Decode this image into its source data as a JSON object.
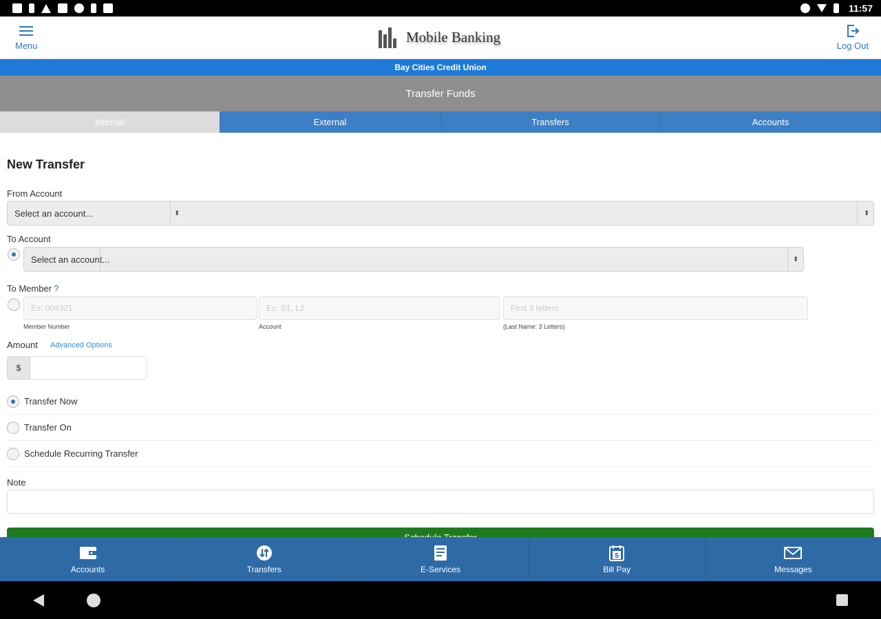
{
  "status_bar": {
    "time": "11:57",
    "left_icons": [
      "app-icon",
      "upload-icon",
      "warning-icon",
      "image-icon",
      "circle-icon",
      "phone-icon",
      "play-store-icon"
    ],
    "right_icons": [
      "data-saver-icon",
      "wifi-icon",
      "battery-icon"
    ]
  },
  "header": {
    "menu_label": "Menu",
    "logo_text": "Mobile Banking",
    "logout_label": "Log Out"
  },
  "bank_name": "Bay Cities Credit Union",
  "page_title": "Transfer Funds",
  "tabs": [
    {
      "label": "Internal",
      "active": true
    },
    {
      "label": "External",
      "active": false
    },
    {
      "label": "Transfers",
      "active": false
    },
    {
      "label": "Accounts",
      "active": false
    }
  ],
  "form": {
    "heading": "New Transfer",
    "from_account": {
      "label": "From Account",
      "value": "Select an account..."
    },
    "to_account": {
      "label": "To Account",
      "value": "Select an account..."
    },
    "to_member": {
      "label": "To Member",
      "help": "?",
      "member_number": {
        "placeholder": "Ex: 004321",
        "hint": "Member Number"
      },
      "account": {
        "placeholder": "Ex: S1, L2",
        "hint": "Account"
      },
      "last_name": {
        "placeholder": "First 3 letters",
        "hint": "(Last Name: 3 Letters)"
      }
    },
    "amount": {
      "label": "Amount",
      "advanced_link": "Advanced Options",
      "currency": "$",
      "value": ""
    },
    "timing_options": [
      {
        "label": "Transfer Now",
        "checked": true
      },
      {
        "label": "Transfer On",
        "checked": false
      },
      {
        "label": "Schedule Recurring Transfer",
        "checked": false
      }
    ],
    "note": {
      "label": "Note",
      "value": ""
    },
    "submit_label": "Schedule Transfer"
  },
  "bottom_nav": [
    {
      "label": "Accounts",
      "icon": "wallet-icon"
    },
    {
      "label": "Transfers",
      "icon": "transfer-icon"
    },
    {
      "label": "E-Services",
      "icon": "document-icon"
    },
    {
      "label": "Bill Pay",
      "icon": "calendar-dollar-icon"
    },
    {
      "label": "Messages",
      "icon": "envelope-icon"
    }
  ],
  "colors": {
    "accent_blue": "#1e7ad8",
    "tab_blue": "#3d7fc4",
    "nav_blue": "#2e6aa6",
    "title_gray": "#8f8f8f",
    "submit_green": "#1e7a1e",
    "link_blue": "#2f8fd8"
  }
}
